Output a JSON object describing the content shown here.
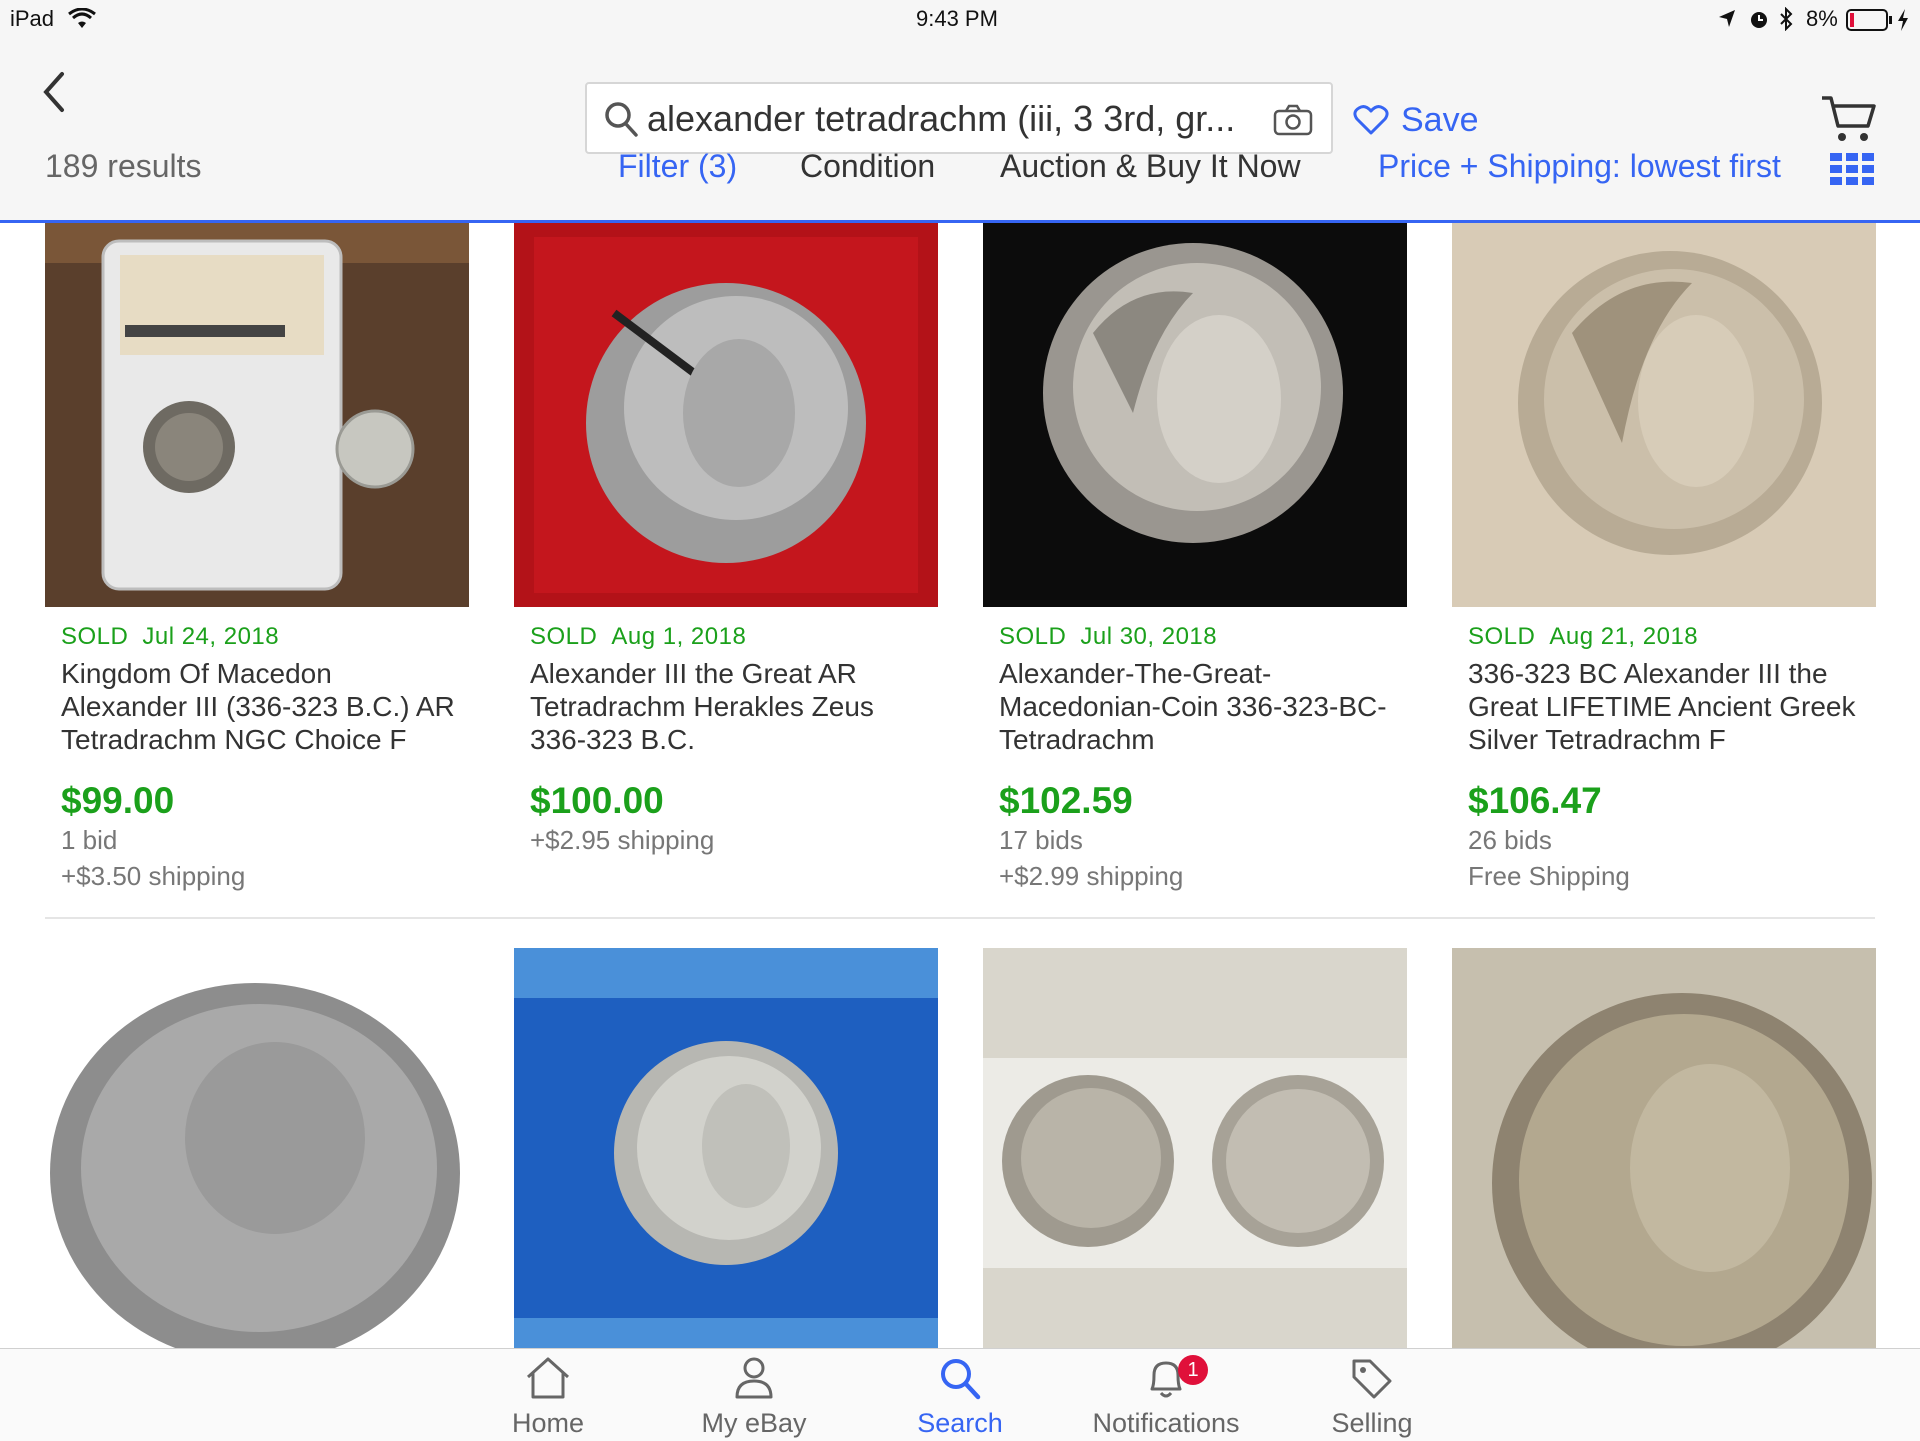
{
  "status_bar": {
    "device": "iPad",
    "time": "9:43 PM",
    "battery": "8%"
  },
  "nav": {
    "search_query": "alexander tetradrachm (iii, 3 3rd, gr...",
    "save_label": "Save"
  },
  "filter_bar": {
    "results_count": "189 results",
    "filter_label": "Filter (3)",
    "condition_label": "Condition",
    "format_label": "Auction & Buy It Now",
    "sort_label": "Price + Shipping: lowest first"
  },
  "listings": [
    {
      "status": "SOLD",
      "date": "Jul 24, 2018",
      "title": "Kingdom Of Macedon Alexander III (336-323 B.C.) AR Tetradrachm NGC Choice F",
      "price": "$99.00",
      "line1": "1 bid",
      "line2": "+$3.50 shipping"
    },
    {
      "status": "SOLD",
      "date": "Aug 1, 2018",
      "title": "Alexander III the Great AR Tetradrachm Herakles Zeus 336-323 B.C.",
      "price": "$100.00",
      "line1": "+$2.95 shipping",
      "line2": ""
    },
    {
      "status": "SOLD",
      "date": "Jul 30, 2018",
      "title": " Alexander-The-Great-Macedonian-Coin 336-323-BC-Tetradrachm",
      "price": "$102.59",
      "line1": "17 bids",
      "line2": "+$2.99 shipping"
    },
    {
      "status": "SOLD",
      "date": "Aug 21, 2018",
      "title": "336-323 BC Alexander III the Great LIFETIME Ancient Greek Silver Tetradrachm F",
      "price": "$106.47",
      "line1": "26 bids",
      "line2": "Free Shipping"
    }
  ],
  "tabs": {
    "home": "Home",
    "my_ebay": "My eBay",
    "search": "Search",
    "notifications": "Notifications",
    "notifications_badge": "1",
    "selling": "Selling"
  },
  "colors": {
    "accent": "#3665f3",
    "price_green": "#1ba01b",
    "badge_red": "#e0103a"
  }
}
